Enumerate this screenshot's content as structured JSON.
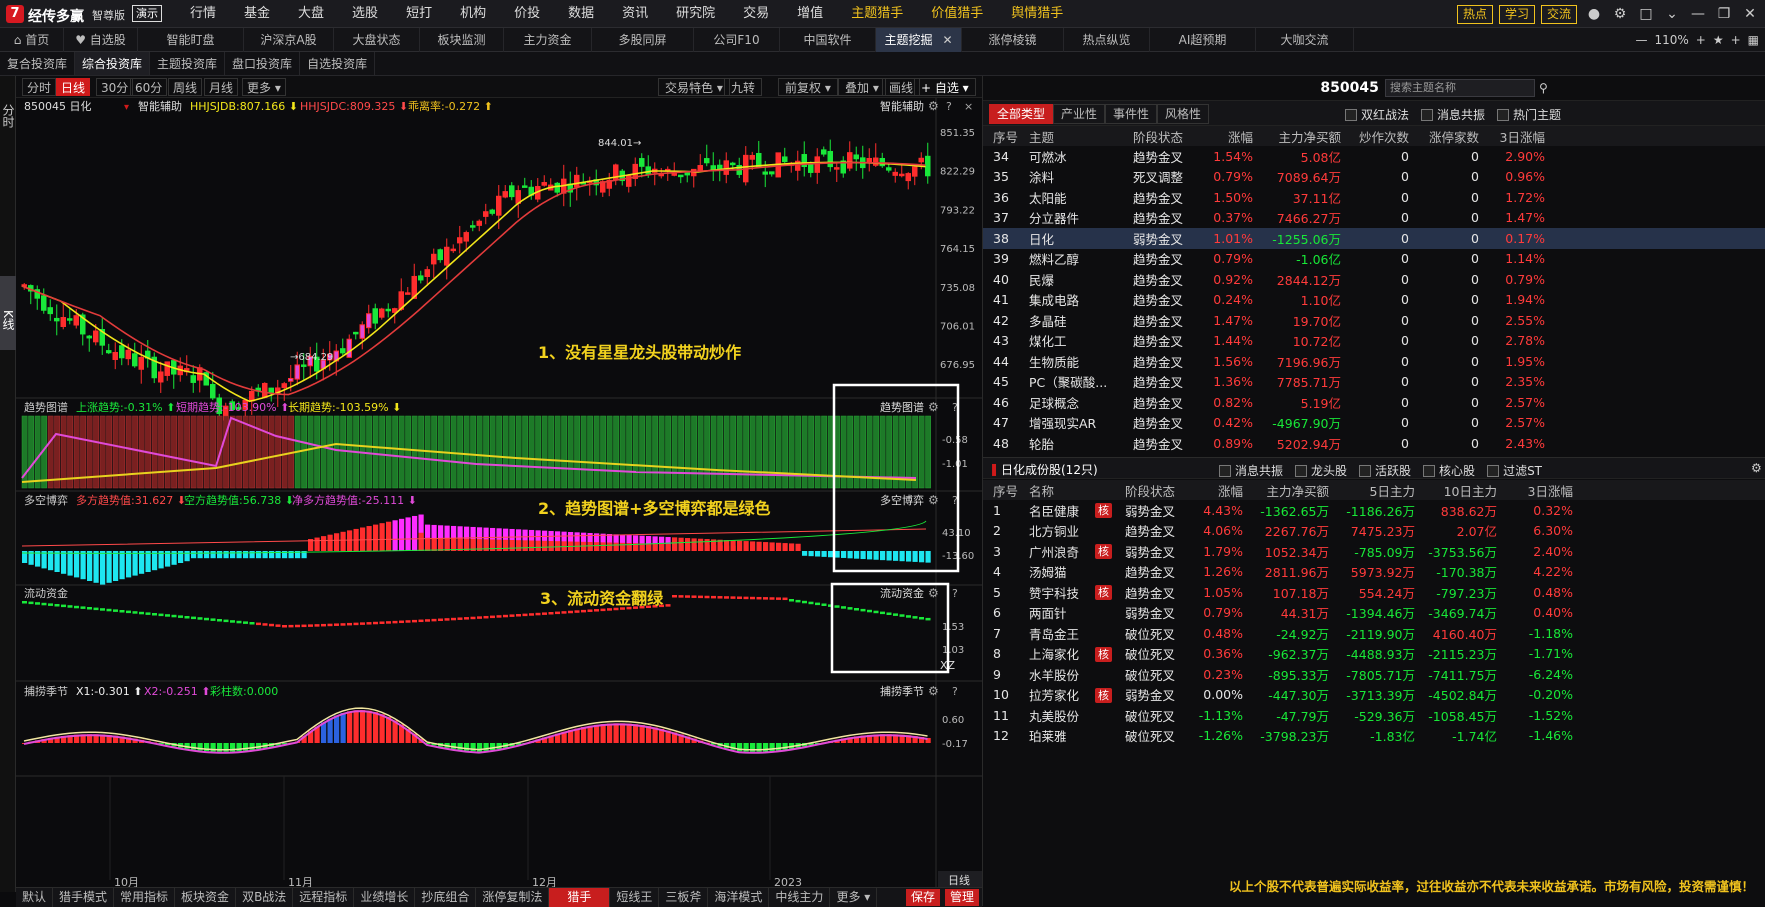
{
  "app": {
    "name": "经传多赢",
    "edition": "智尊版",
    "demo": "演示"
  },
  "menu": [
    "行情",
    "基金",
    "大盘",
    "选股",
    "短打",
    "机构",
    "价投",
    "数据",
    "资讯",
    "研究院",
    "交易",
    "增值",
    "主题猎手",
    "价值猎手",
    "舆情猎手"
  ],
  "menu_highlight": [
    "主题猎手",
    "价值猎手",
    "舆情猎手"
  ],
  "top_buttons": [
    "热点",
    "学习",
    "交流"
  ],
  "tabs": [
    "首页",
    "自选股",
    "智能盯盘",
    "沪深京A股",
    "大盘状态",
    "板块监测",
    "主力资金",
    "多股同屏",
    "公司F10",
    "中国软件",
    "主题挖掘",
    "涨停棱镜",
    "热点纵览",
    "AI超预期",
    "大咖交流"
  ],
  "active_tab": "主题挖掘",
  "zoom": "110%",
  "subtabs": [
    "复合投资库",
    "综合投资库",
    "主题投资库",
    "盘口投资库",
    "自选投资库"
  ],
  "active_subtab": "综合投资库",
  "left_strip": {
    "fenshi": "分时",
    "kxian": "K线"
  },
  "periods": [
    "分时",
    "日线",
    "30分",
    "60分",
    "周线",
    "月线",
    "更多"
  ],
  "active_period": "日线",
  "chart_tools": [
    "交易特色",
    "九转",
    "前复权",
    "叠加",
    "画线",
    "自选"
  ],
  "main_chart": {
    "code_name": "850045 日化",
    "assist": "智能辅助",
    "ind1": "HHJSJDB:807.166",
    "ind2": "HHJSJDC:809.325",
    "ind3": "乖离率:-0.272",
    "high_label": "844.01",
    "low_label": "684.29",
    "annotation": "1、没有星星龙头股带动炒作"
  },
  "trend_panel": {
    "title": "趋势图谱",
    "up": "上涨趋势:-0.31%",
    "short": "短期趋势:-103.90%",
    "long": "长期趋势:-103.59%",
    "annotation": "2、趋势图谱+多空博弈都是绿色"
  },
  "bull_panel": {
    "title": "多空博弈",
    "a": "多方趋势值:31.627",
    "b": "空方趋势值:56.738",
    "c": "净多方趋势值:-25.111"
  },
  "flow_panel": {
    "title": "流动资金",
    "annotation": "3、流动资金翻绿",
    "xz": "XZ"
  },
  "season_panel": {
    "title": "捕捞季节",
    "x1": "X1:-0.301",
    "x2": "X2:-0.251",
    "cz": "彩柱数:0.000"
  },
  "axis": {
    "main": [
      "851.35",
      "822.29",
      "793.22",
      "764.15",
      "735.08",
      "706.01",
      "676.95"
    ],
    "trend": [
      "-0.58",
      "-1.01"
    ],
    "bull": [
      "43.10",
      "-13.60"
    ],
    "flow": [
      "1.53",
      "1.03"
    ],
    "season": [
      "0.60",
      "-0.17"
    ],
    "months": [
      "10月",
      "11月",
      "12月",
      "2023"
    ],
    "period_btn": "日线"
  },
  "bottom_tabs": [
    "默认",
    "猎手模式",
    "常用指标",
    "板块资金",
    "双B战法",
    "远程指标",
    "业绩增长",
    "抄底组合",
    "涨停复制法",
    "猎手",
    "短线王",
    "三板斧",
    "海洋模式",
    "中线主力",
    "更多"
  ],
  "active_bottom_tab": "猎手",
  "bottom_actions": [
    "保存",
    "管理"
  ],
  "right": {
    "title": "850045 日化",
    "search_placeholder": "搜索主题名称",
    "cat_tabs": [
      "全部类型",
      "产业性",
      "事件性",
      "风格性"
    ],
    "checks": [
      "双红战法",
      "消息共振",
      "热门主题"
    ],
    "theme_headers": [
      "序号",
      "主题",
      "阶段状态",
      "涨幅",
      "主力净买额",
      "炒作次数",
      "涨停家数",
      "3日涨幅"
    ],
    "theme_rows": [
      [
        "34",
        "可燃冰",
        "趋势金叉",
        "1.54%",
        "5.08亿",
        "0",
        "0",
        "2.90%"
      ],
      [
        "35",
        "涂料",
        "死叉调整",
        "0.79%",
        "7089.64万",
        "0",
        "0",
        "0.96%"
      ],
      [
        "36",
        "太阳能",
        "趋势金叉",
        "1.50%",
        "37.11亿",
        "0",
        "0",
        "1.72%"
      ],
      [
        "37",
        "分立器件",
        "趋势金叉",
        "0.37%",
        "7466.27万",
        "0",
        "0",
        "1.47%"
      ],
      [
        "38",
        "日化",
        "弱势金叉",
        "1.01%",
        "-1255.06万",
        "0",
        "0",
        "0.17%"
      ],
      [
        "39",
        "燃料乙醇",
        "趋势金叉",
        "0.79%",
        "-1.06亿",
        "0",
        "0",
        "1.14%"
      ],
      [
        "40",
        "民爆",
        "趋势金叉",
        "0.92%",
        "2844.12万",
        "0",
        "0",
        "0.79%"
      ],
      [
        "41",
        "集成电路",
        "趋势金叉",
        "0.24%",
        "1.10亿",
        "0",
        "0",
        "1.94%"
      ],
      [
        "42",
        "多晶硅",
        "趋势金叉",
        "1.47%",
        "19.70亿",
        "0",
        "0",
        "2.55%"
      ],
      [
        "43",
        "煤化工",
        "趋势金叉",
        "1.44%",
        "10.72亿",
        "0",
        "0",
        "2.78%"
      ],
      [
        "44",
        "生物质能",
        "趋势金叉",
        "1.56%",
        "7196.96万",
        "0",
        "0",
        "1.95%"
      ],
      [
        "45",
        "PC（聚碳酸...",
        "趋势金叉",
        "1.36%",
        "7785.71万",
        "0",
        "0",
        "2.35%"
      ],
      [
        "46",
        "足球概念",
        "趋势金叉",
        "0.82%",
        "5.19亿",
        "0",
        "0",
        "2.57%"
      ],
      [
        "47",
        "增强现实AR",
        "趋势金叉",
        "0.42%",
        "-4967.90万",
        "0",
        "0",
        "2.57%"
      ],
      [
        "48",
        "轮胎",
        "趋势金叉",
        "0.89%",
        "5202.94万",
        "0",
        "0",
        "2.43%"
      ]
    ],
    "selected_theme": "38",
    "stock_section_title": "日化成份股(12只)",
    "stock_checks": [
      "消息共振",
      "龙头股",
      "活跃股",
      "核心股",
      "过滤ST"
    ],
    "stock_headers": [
      "序号",
      "名称",
      "",
      "阶段状态",
      "涨幅",
      "主力净买额",
      "5日主力",
      "10日主力",
      "3日涨幅"
    ],
    "core_tag": "核",
    "stock_rows": [
      [
        "1",
        "名臣健康",
        "核",
        "弱势金叉",
        "4.43%",
        "-1362.65万",
        "-1186.26万",
        "838.62万",
        "0.32%"
      ],
      [
        "2",
        "北方铜业",
        "",
        "趋势金叉",
        "4.06%",
        "2267.76万",
        "7475.23万",
        "2.07亿",
        "6.30%"
      ],
      [
        "3",
        "广州浪奇",
        "核",
        "弱势金叉",
        "1.79%",
        "1052.34万",
        "-785.09万",
        "-3753.56万",
        "2.40%"
      ],
      [
        "4",
        "汤姆猫",
        "",
        "趋势金叉",
        "1.26%",
        "2811.96万",
        "5973.92万",
        "-170.38万",
        "4.22%"
      ],
      [
        "5",
        "赞宇科技",
        "核",
        "趋势金叉",
        "1.05%",
        "107.18万",
        "554.24万",
        "-797.23万",
        "0.48%"
      ],
      [
        "6",
        "两面针",
        "",
        "弱势金叉",
        "0.79%",
        "44.31万",
        "-1394.46万",
        "-3469.74万",
        "0.40%"
      ],
      [
        "7",
        "青岛金王",
        "",
        "破位死叉",
        "0.48%",
        "-24.92万",
        "-2119.90万",
        "4160.40万",
        "-1.18%"
      ],
      [
        "8",
        "上海家化",
        "核",
        "破位死叉",
        "0.36%",
        "-962.37万",
        "-4488.93万",
        "-2115.23万",
        "-1.71%"
      ],
      [
        "9",
        "水羊股份",
        "",
        "破位死叉",
        "0.23%",
        "-895.33万",
        "-7805.71万",
        "-7411.75万",
        "-6.24%"
      ],
      [
        "10",
        "拉芳家化",
        "核",
        "弱势金叉",
        "0.00%",
        "-447.30万",
        "-3713.39万",
        "-4502.84万",
        "-0.20%"
      ],
      [
        "11",
        "丸美股份",
        "",
        "破位死叉",
        "-1.13%",
        "-47.79万",
        "-529.36万",
        "-1058.45万",
        "-1.52%"
      ],
      [
        "12",
        "珀莱雅",
        "",
        "破位死叉",
        "-1.26%",
        "-3798.23万",
        "-1.83亿",
        "-1.74亿",
        "-1.46%"
      ]
    ],
    "disclaimer": "以上个股不代表普遍实际收益率，过往收益亦不代表未来收益承诺。市场有风险，投资需谨慎！"
  },
  "colors": {
    "up": "#ff3b3b",
    "down": "#18e838",
    "accent": "#f0c21e",
    "selected_row": "#26324a"
  }
}
